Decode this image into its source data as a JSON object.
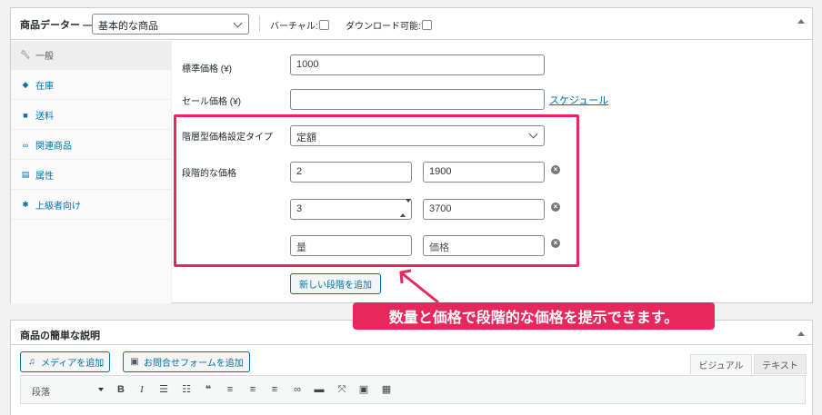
{
  "product_data": {
    "title": "商品データー —",
    "product_type": "基本的な商品",
    "virtual_label": "バーチャル:",
    "downloadable_label": "ダウンロード可能:"
  },
  "tabs": [
    {
      "label": "一般",
      "icon": "wrench-icon",
      "active": true
    },
    {
      "label": "在庫",
      "icon": "tag-icon",
      "active": false
    },
    {
      "label": "送料",
      "icon": "truck-icon",
      "active": false
    },
    {
      "label": "関連商品",
      "icon": "link-icon",
      "active": false
    },
    {
      "label": "属性",
      "icon": "list-icon",
      "active": false
    },
    {
      "label": "上級者向け",
      "icon": "gear-icon",
      "active": false
    }
  ],
  "general": {
    "regular_price_label": "標準価格 (¥)",
    "regular_price_value": "1000",
    "sale_price_label": "セール価格 (¥)",
    "sale_price_value": "",
    "schedule_link": "スケジュール",
    "tier_type_label": "階層型価格設定タイプ",
    "tier_type_value": "定額",
    "tier_prices_label": "段階的な価格",
    "tiers": [
      {
        "qty": "2",
        "price": "1900"
      },
      {
        "qty": "3",
        "price": "3700"
      }
    ],
    "qty_placeholder": "量",
    "price_placeholder": "価格",
    "add_tier_button": "新しい段階を追加"
  },
  "callout": "数量と価格で段階的な価格を提示できます。",
  "colors": {
    "accent": "#e8285c",
    "link": "#0073aa"
  },
  "short_description": {
    "title": "商品の簡単な説明",
    "add_media_button": "メディアを追加",
    "add_form_button": "お問合せフォームを追加",
    "tab_visual": "ビジュアル",
    "tab_text": "テキスト",
    "format_select": "段落"
  }
}
